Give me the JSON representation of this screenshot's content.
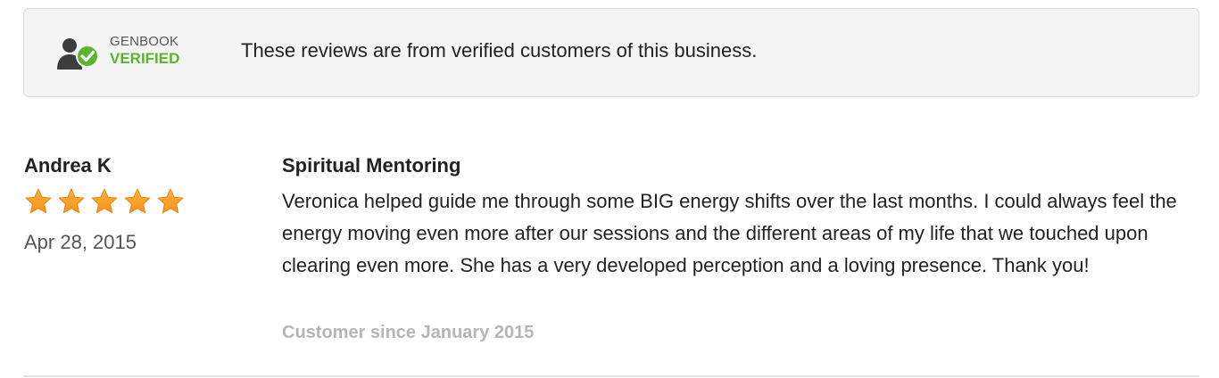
{
  "banner": {
    "badge_top": "GENBOOK",
    "badge_bottom": "VERIFIED",
    "message": "These reviews are from verified customers of this business."
  },
  "review": {
    "reviewer": "Andrea K",
    "rating": 5,
    "rating_max": 5,
    "date": "Apr 28, 2015",
    "service": "Spiritual Mentoring",
    "body": "Veronica helped guide me through some BIG energy shifts over the last months. I could always feel the energy moving even more after our sessions and the different areas of my life that we touched upon clearing even more. She has a very developed perception and a loving presence. Thank you!",
    "customer_since": "Customer since January 2015"
  },
  "colors": {
    "star": "#f7931e",
    "verified_green": "#5cb531",
    "banner_bg": "#f4f4f4",
    "muted_text": "#b5b5b5"
  },
  "icons": {
    "badge_icon": "verified-user-check-icon",
    "star_icon": "star-icon"
  }
}
